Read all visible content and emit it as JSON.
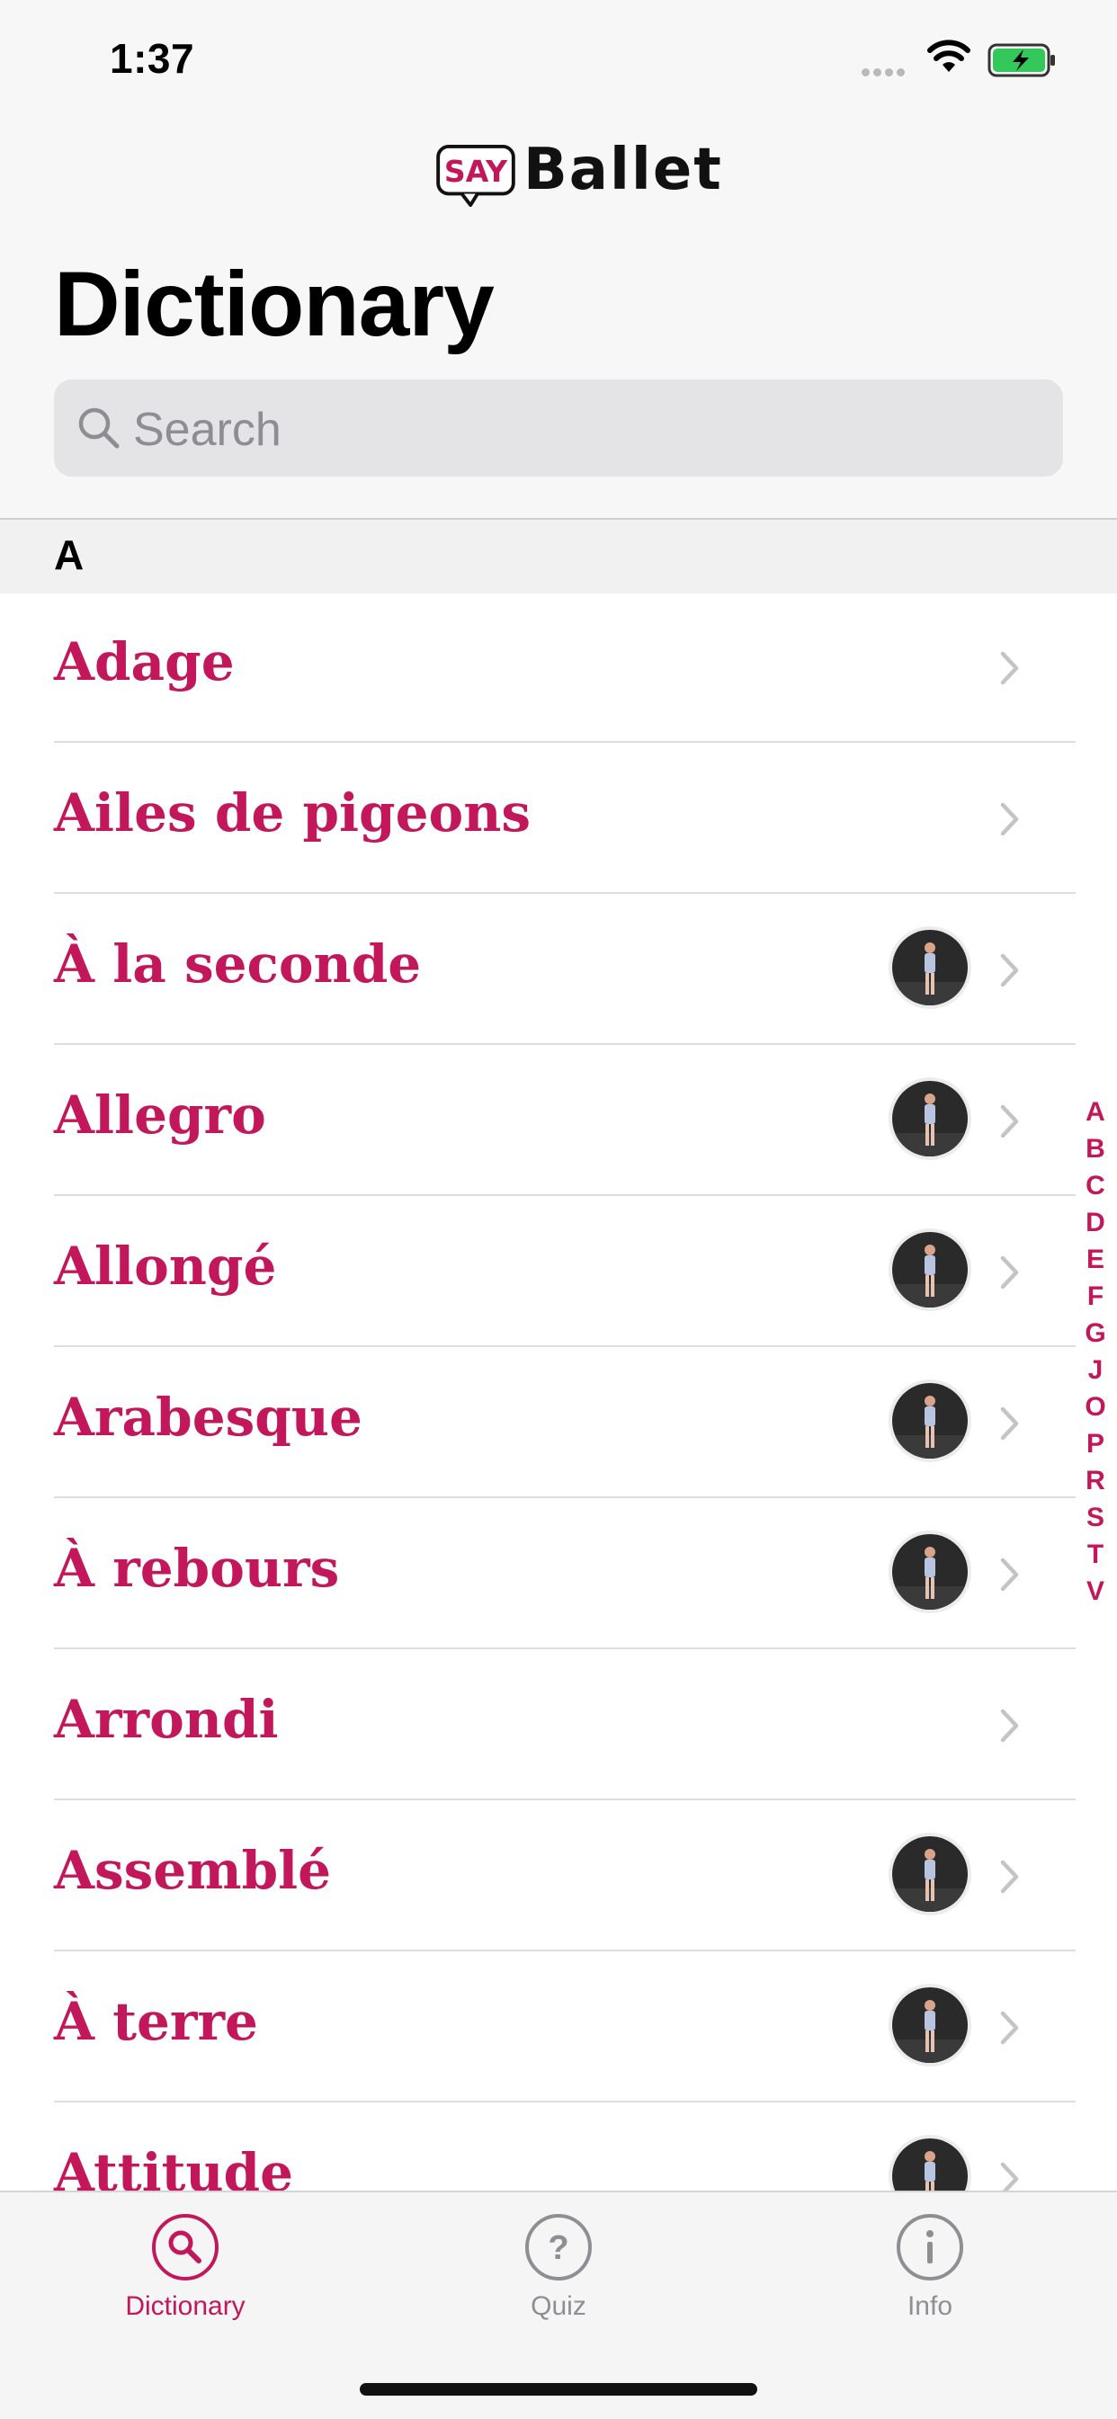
{
  "status_bar": {
    "time": "1:37"
  },
  "header": {
    "logo_badge": "SAY",
    "logo_text": "Ballet",
    "title": "Dictionary",
    "search_placeholder": "Search"
  },
  "section": {
    "letter": "A"
  },
  "entries": [
    {
      "label": "Adage",
      "has_thumbnail": false
    },
    {
      "label": "Ailes de pigeons",
      "has_thumbnail": false
    },
    {
      "label": "À la seconde",
      "has_thumbnail": true
    },
    {
      "label": "Allegro",
      "has_thumbnail": true
    },
    {
      "label": "Allongé",
      "has_thumbnail": true
    },
    {
      "label": "Arabesque",
      "has_thumbnail": true
    },
    {
      "label": "À rebours",
      "has_thumbnail": true
    },
    {
      "label": "Arrondi",
      "has_thumbnail": false
    },
    {
      "label": "Assemblé",
      "has_thumbnail": true
    },
    {
      "label": "À terre",
      "has_thumbnail": true
    },
    {
      "label": "Attitude",
      "has_thumbnail": true
    }
  ],
  "index_letters": [
    "A",
    "B",
    "C",
    "D",
    "E",
    "F",
    "G",
    "J",
    "O",
    "P",
    "R",
    "S",
    "T",
    "V"
  ],
  "tabs": [
    {
      "label": "Dictionary",
      "icon": "search-icon",
      "active": true
    },
    {
      "label": "Quiz",
      "icon": "question-icon",
      "active": false
    },
    {
      "label": "Info",
      "icon": "info-icon",
      "active": false
    }
  ],
  "colors": {
    "accent": "#c2185b",
    "inactive": "#8e8e93"
  }
}
